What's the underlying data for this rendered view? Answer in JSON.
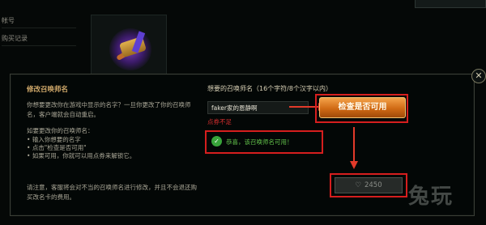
{
  "sidebar": {
    "items": [
      {
        "label": "帐号"
      },
      {
        "label": "购买记录"
      }
    ]
  },
  "modal": {
    "title": "修改召唤师名",
    "close_glyph": "✕",
    "intro": "你想要更改你在游戏中显示的名字？一旦你更改了你的召唤师名，客户端就会自动重启。",
    "howto_heading": "如要更改你的召唤师名：",
    "steps": [
      "输入你想要的名字",
      "点击\"检查是否可用\"",
      "如果可用，你就可以用点券来解锁它。"
    ],
    "notice": "请注意，客服将会对不当的召唤师名进行修改，并且不会退还购买改名卡的费用。",
    "field_label": "想要的召唤师名（16个字符/8个汉字以内）",
    "name_value": "faker家的恩静啊",
    "error_text": "点券不足",
    "check_button": "检查是否可用",
    "success_text": "恭喜，该召唤师名可用！",
    "price": "2450"
  },
  "watermark": "兔玩",
  "colors": {
    "accent_orange": "#d06a14",
    "annotation_red": "#d61e1e",
    "success_green": "#38a43a",
    "title_gold": "#cfa86a"
  },
  "icons": {
    "check": "checkmark-icon",
    "currency": "heart-icon",
    "close": "close-icon"
  }
}
